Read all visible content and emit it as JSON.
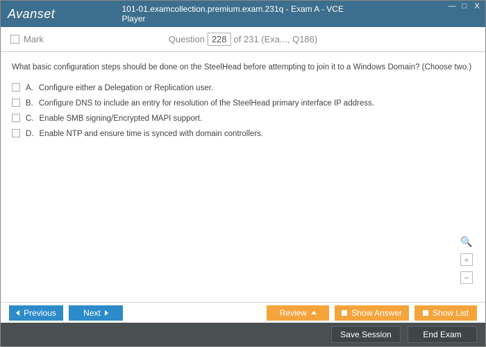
{
  "window": {
    "logo": "Avanset",
    "title": "101-01.examcollection.premium.exam.231q - Exam A - VCE Player",
    "min": "—",
    "max": "□",
    "close": "X"
  },
  "header": {
    "mark_label": "Mark",
    "question_label": "Question",
    "current": "228",
    "total_suffix": "of 231 (Exa..., Q186)"
  },
  "question": {
    "text": "What basic configuration steps should be done on the SteelHead before attempting to join it to a Windows Domain? (Choose two.)",
    "options": [
      {
        "letter": "A.",
        "text": "Configure either a Delegation or Replication user."
      },
      {
        "letter": "B.",
        "text": "Configure DNS to include an entry for resolution of the SteelHead primary interface IP address."
      },
      {
        "letter": "C.",
        "text": "Enable SMB signing/Encrypted MAPI support."
      },
      {
        "letter": "D.",
        "text": "Enable NTP and ensure time is synced with domain controllers."
      }
    ]
  },
  "tools": {
    "mag": "🔍",
    "plus": "+",
    "minus": "−"
  },
  "footer": {
    "previous": "Previous",
    "next": "Next",
    "review": "Review",
    "show_answer": "Show Answer",
    "show_list": "Show List",
    "save_session": "Save Session",
    "end_exam": "End Exam"
  }
}
